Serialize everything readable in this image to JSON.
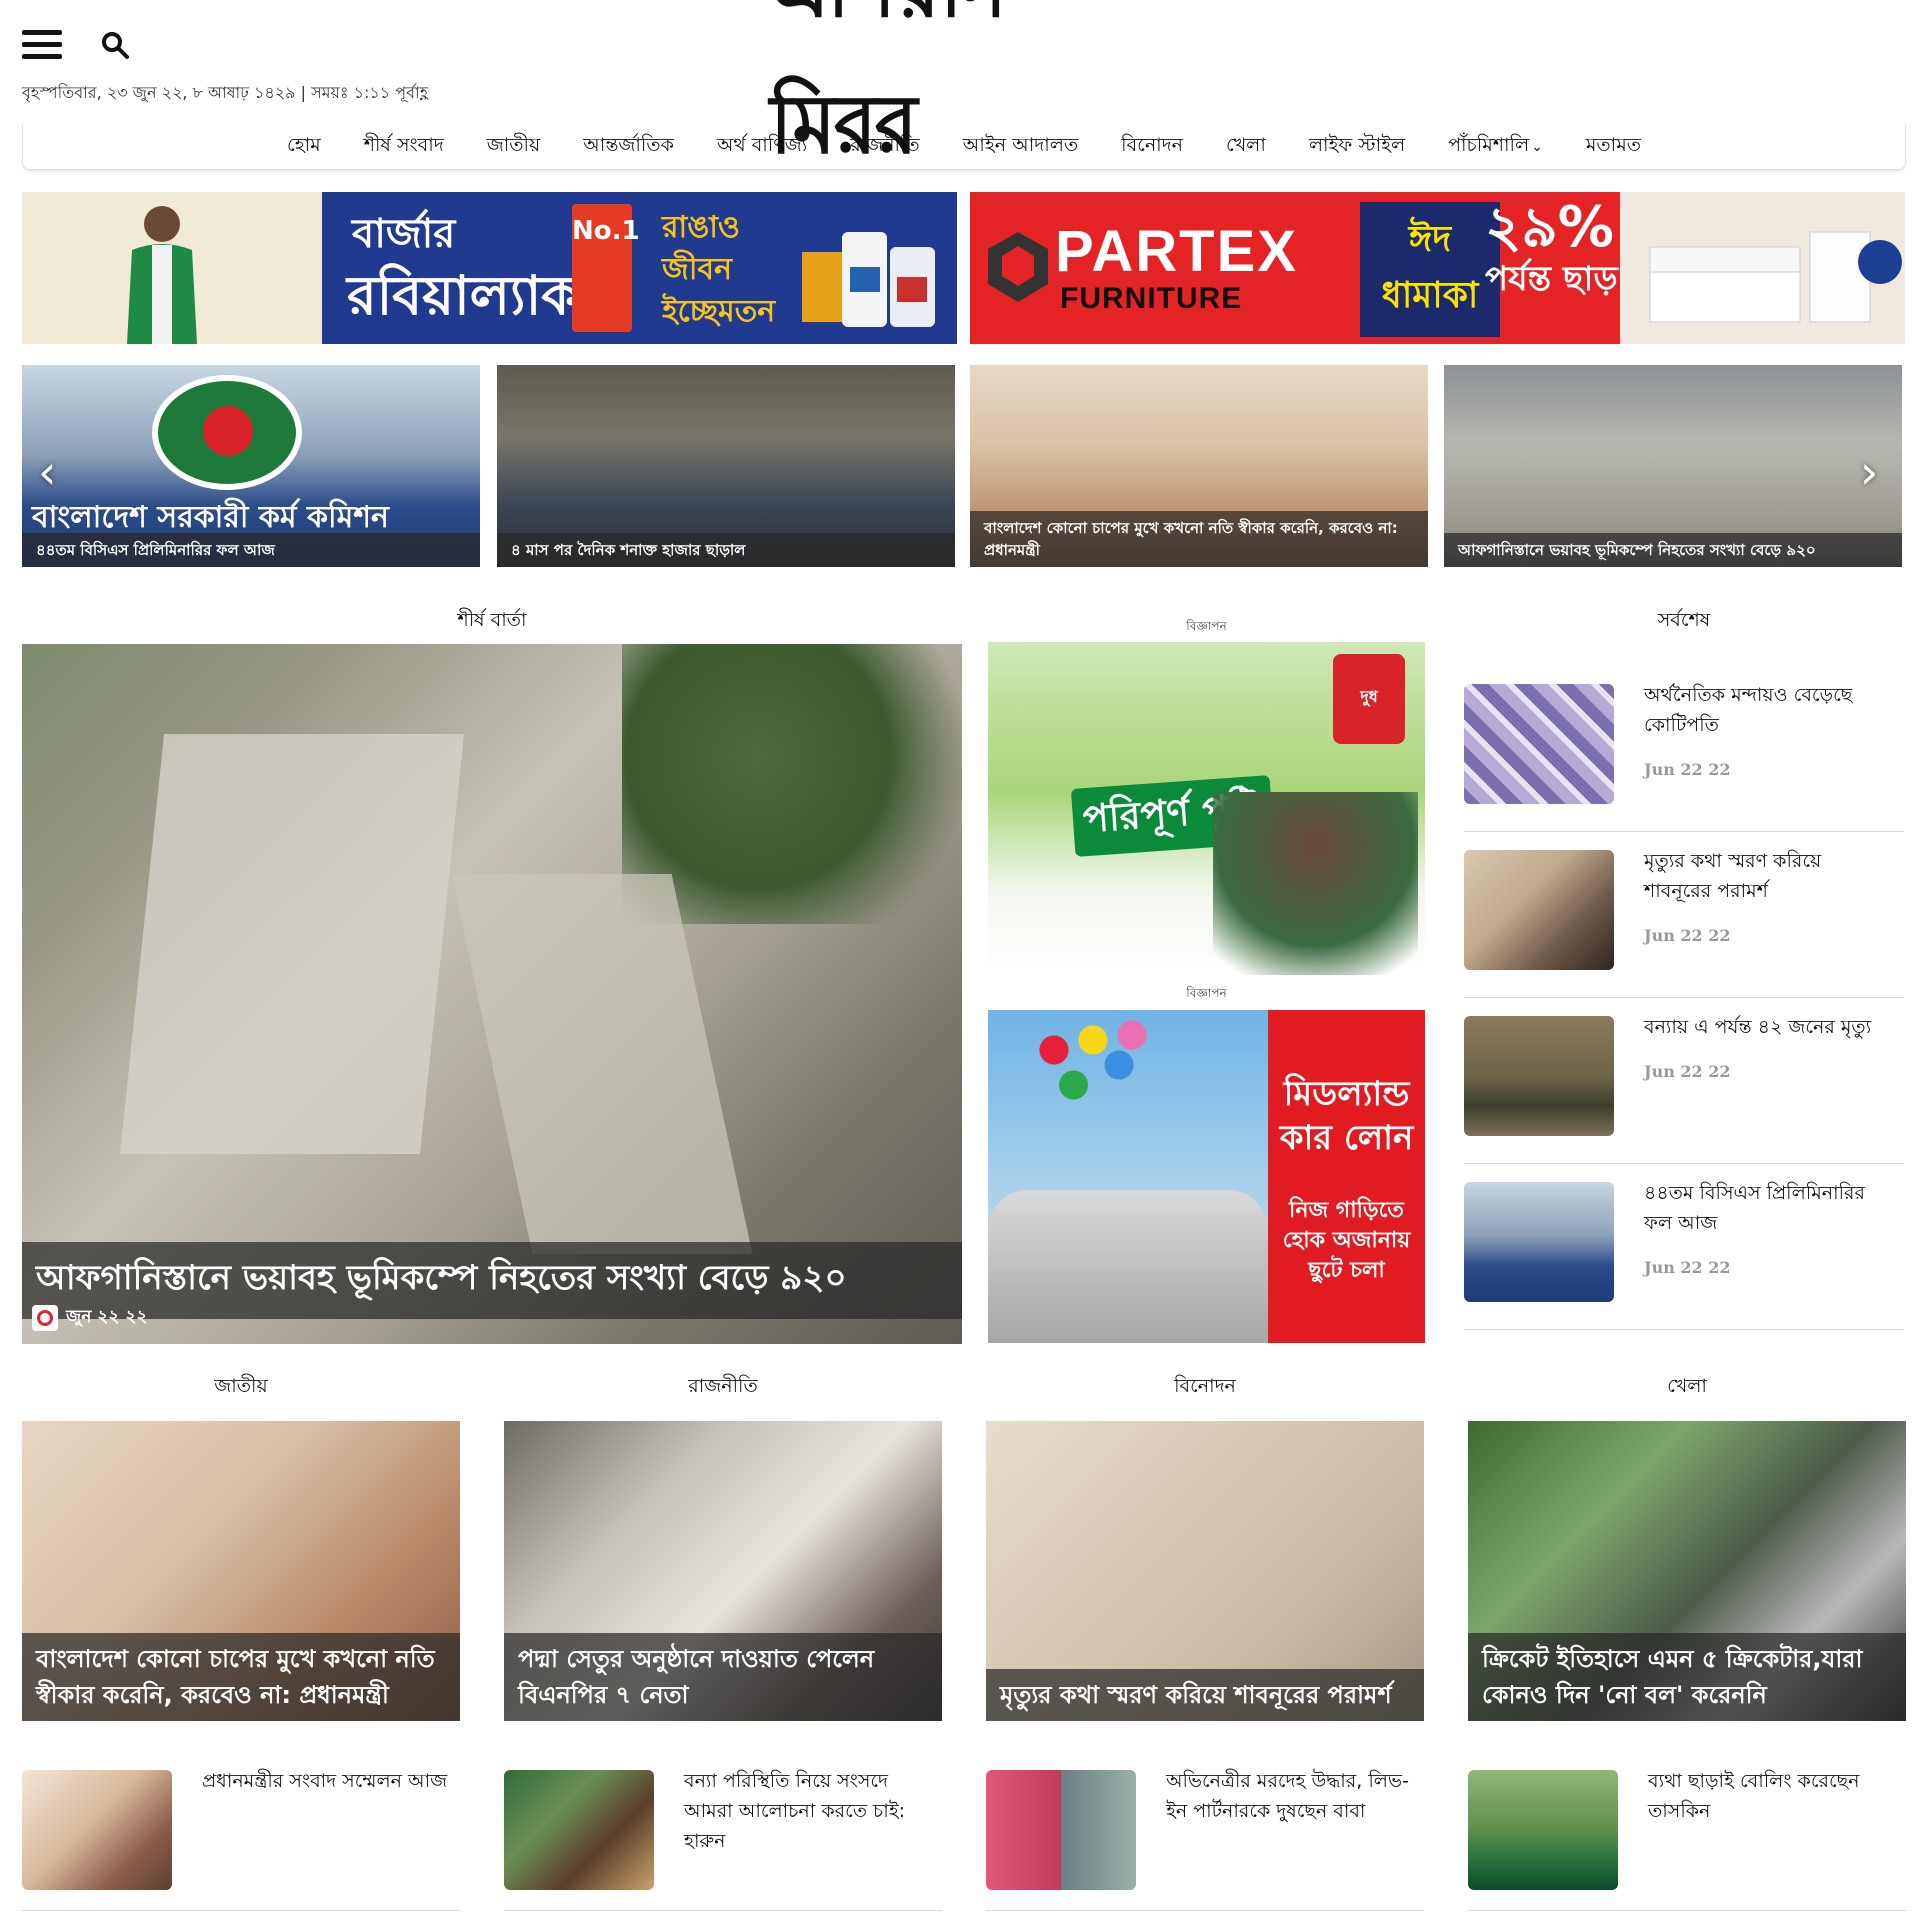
{
  "header": {
    "logo_text": "এশিয়ান মিরর",
    "date_line": "বৃহস্পতিবার, ২৩ জুন ২২, ৮ আষাঢ় ১৪২৯ | সময়ঃ ১:১১ পূর্বাহ্ণ"
  },
  "nav": {
    "items": [
      "হোম",
      "শীর্ষ সংবাদ",
      "জাতীয়",
      "আন্তর্জাতিক",
      "অর্থ বাণিজ্য",
      "রাজনীতি",
      "আইন আদালত",
      "বিনোদন",
      "খেলা",
      "লাইফ স্টাইল",
      "পাঁচমিশালি",
      "মতামত"
    ]
  },
  "ads": {
    "left": {
      "brand_top": "বার্জার",
      "brand_main": "রবিয়াল্যাক",
      "badge": "No.1",
      "tagline_1": "রাঙাও",
      "tagline_2": "জীবন",
      "tagline_3": "ইচ্ছেমতন"
    },
    "right": {
      "brand": "PARTEX",
      "sub": "FURNITURE",
      "promo": "ঈদ ধামাকা",
      "discount_1": "২৯%",
      "discount_2": "পর্যন্ত ছাড়!"
    },
    "milk": {
      "label": "বিজ্ঞাপন",
      "logo": "দুধ",
      "title": "পরিপূর্ণ পুষ্টি"
    },
    "car": {
      "label": "বিজ্ঞাপন",
      "title": "মিডল্যান্ড কার লোন",
      "sub": "নিজ গাড়িতে হোক অজানায় ছুটে চলা"
    }
  },
  "slider": {
    "slide1_overlay": "বাংলাদেশ সরকারী কর্ম কমিশন",
    "items": [
      "৪৪তম বিসিএস প্রিলিমিনারির ফল আজ",
      "৪ মাস পর দৈনিক শনাক্ত হাজার ছাড়াল",
      "বাংলাদেশ কোনো চাপের মুখে কখনো নতি স্বীকার করেনি, করবেও না: প্রধানমন্ত্রী",
      "আফগানিস্তানে ভয়াবহ ভূমিকম্পে নিহতের সংখ্যা বেড়ে ৯২০"
    ]
  },
  "sections": {
    "top_news": "শীর্ষ বার্তা",
    "latest": "সর্বশেষ",
    "national": "জাতীয়",
    "politics": "রাজনীতি",
    "entertainment": "বিনোদন",
    "sports": "খেলা"
  },
  "top_story": {
    "headline": "আফগানিস্তানে ভয়াবহ ভূমিকম্পে নিহতের সংখ্যা বেড়ে ৯২০",
    "date": "জুন ২২ ২২"
  },
  "latest": [
    {
      "title": "অর্থনৈতিক মন্দায়ও বেড়েছে কোটিপতি",
      "date": "Jun 22 22"
    },
    {
      "title": "মৃত্যুর কথা স্মরণ করিয়ে শাবনূরের পরামর্শ",
      "date": "Jun 22 22"
    },
    {
      "title": "বন্যায় এ পর্যন্ত ৪২ জনের মৃত্যু",
      "date": "Jun 22 22"
    },
    {
      "title": "৪৪তম বিসিএস প্রিলিমিনারির ফল আজ",
      "date": "Jun 22 22"
    }
  ],
  "category_cards": [
    "বাংলাদেশ কোনো চাপের মুখে কখনো নতি স্বীকার করেনি, করবেও না: প্রধানমন্ত্রী",
    "পদ্মা সেতুর অনুষ্ঠানে দাওয়াত পেলেন বিএনপির ৭ নেতা",
    "মৃত্যুর কথা স্মরণ করিয়ে শাবনূরের পরামর্শ",
    "ক্রিকেট ইতিহাসে এমন ৫ ক্রিকেটার,যারা কোনও দিন 'নো বল' করেননি"
  ],
  "small_items": [
    "প্রধানমন্ত্রীর সংবাদ সম্মেলন আজ",
    "বন্যা পরিস্থিতি নিয়ে সংসদে আমরা আলোচনা করতে চাই: হারুন",
    "অভিনেত্রীর মরদেহ উদ্ধার, লিভ-ইন পার্টনারকে দুষছেন বাবা",
    "ব্যথা ছাড়াই বোলিং করেছেন তাসকিন"
  ],
  "colors": {
    "accent_red": "#e42326",
    "ad_blue": "#203a8f",
    "caption_bg": "rgba(40,40,40,.72)",
    "date_gray": "#999999"
  },
  "icons": {
    "menu": "hamburger-icon",
    "search": "search-icon",
    "prev": "chevron-left-icon",
    "next": "chevron-right-icon",
    "clock": "clock-icon",
    "dropdown": "chevron-down-icon"
  }
}
